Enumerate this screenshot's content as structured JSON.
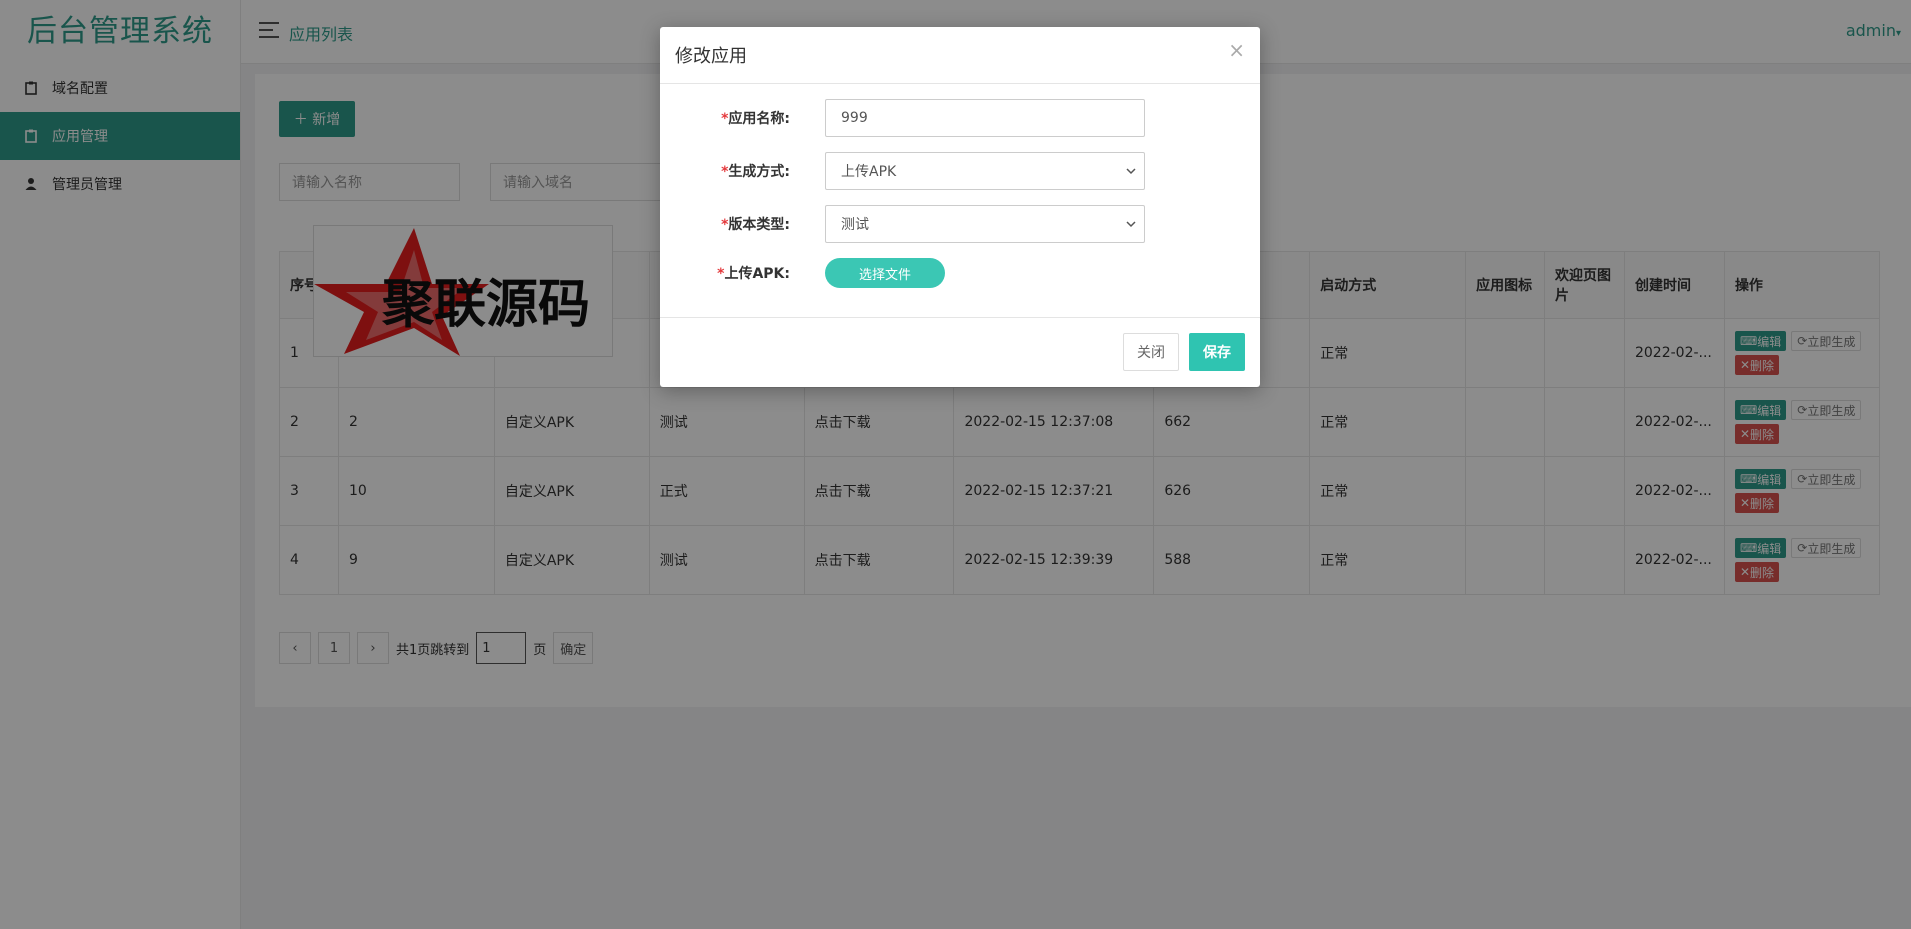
{
  "app": {
    "title": "后台管理系统",
    "user": "admin"
  },
  "sidebar": {
    "items": [
      {
        "label": "域名配置",
        "icon": "clipboard-icon",
        "active": false
      },
      {
        "label": "应用管理",
        "icon": "clipboard-icon",
        "active": true
      },
      {
        "label": "管理员管理",
        "icon": "user-icon",
        "active": false
      }
    ]
  },
  "header": {
    "page_title": "应用列表"
  },
  "toolbar": {
    "add_label": "＋ 新增"
  },
  "filters": {
    "name_placeholder": "请输入名称",
    "domain_placeholder": "请输入域名"
  },
  "table": {
    "headers": [
      "序号",
      "",
      "",
      "",
      "",
      "",
      "",
      "启动方式",
      "应用图标",
      "欢迎页图片",
      "创建时间",
      "操作"
    ],
    "rows": [
      {
        "idx": "1",
        "name": "",
        "mode": "",
        "type": "",
        "download": "",
        "updated": "",
        "size": "",
        "startup": "正常",
        "created": "2022-02-..."
      },
      {
        "idx": "2",
        "name": "2",
        "mode": "自定义APK",
        "type": "测试",
        "download": "点击下载",
        "updated": "2022-02-15 12:37:08",
        "size": "662",
        "startup": "正常",
        "created": "2022-02-..."
      },
      {
        "idx": "3",
        "name": "10",
        "mode": "自定义APK",
        "type": "正式",
        "download": "点击下载",
        "updated": "2022-02-15 12:37:21",
        "size": "626",
        "startup": "正常",
        "created": "2022-02-..."
      },
      {
        "idx": "4",
        "name": "9",
        "mode": "自定义APK",
        "type": "测试",
        "download": "点击下载",
        "updated": "2022-02-15 12:39:39",
        "size": "588",
        "startup": "正常",
        "created": "2022-02-..."
      }
    ],
    "ops": {
      "edit": "编辑",
      "generate": "立即生成",
      "delete": "删除"
    }
  },
  "pager": {
    "prev": "‹",
    "page": "1",
    "next": "›",
    "total_text": "共1页跳转到",
    "input": "1",
    "unit": "页",
    "confirm": "确定"
  },
  "watermark": {
    "text": "聚联源码"
  },
  "modal": {
    "title": "修改应用",
    "close": "×",
    "fields": [
      {
        "label": "应用名称:",
        "value": "999"
      },
      {
        "label": "生成方式:",
        "value": "上传APK"
      },
      {
        "label": "版本类型:",
        "value": "测试"
      },
      {
        "label": "上传APK:",
        "button": "选择文件"
      }
    ],
    "cancel": "关闭",
    "save": "保存"
  },
  "colors": {
    "accent": "#2f9c8a",
    "danger": "#d9534f",
    "required": "#e4393c"
  }
}
